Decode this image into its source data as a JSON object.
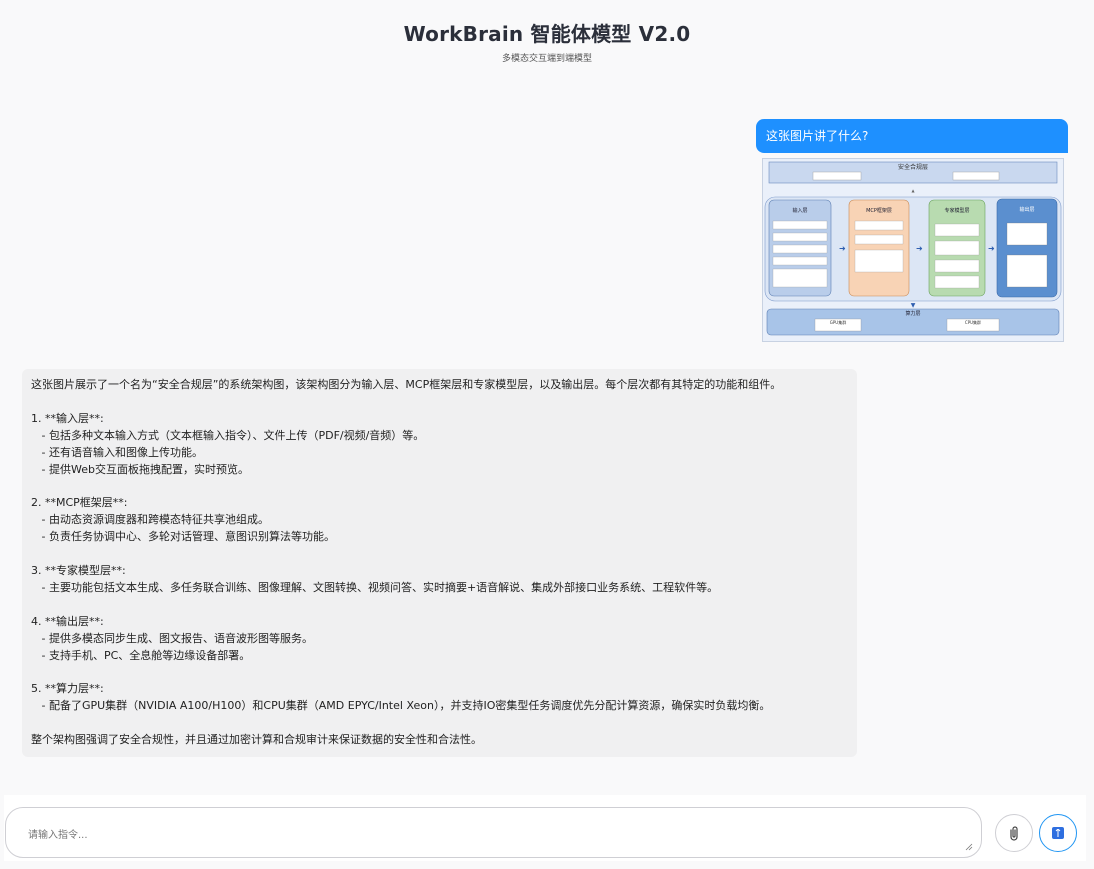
{
  "header": {
    "title": "WorkBrain 智能体模型 V2.0",
    "subtitle": "多模态交互端到端模型"
  },
  "conversation": {
    "user_message": "这张图片讲了什么?",
    "assistant_message": "这张图片展示了一个名为“安全合规层”的系统架构图，该架构图分为输入层、MCP框架层和专家模型层，以及输出层。每个层次都有其特定的功能和组件。\n\n1. **输入层**:\n   - 包括多种文本输入方式（文本框输入指令）、文件上传（PDF/视频/音频）等。\n   - 还有语音输入和图像上传功能。\n   - 提供Web交互面板拖拽配置，实时预览。\n\n2. **MCP框架层**:\n   - 由动态资源调度器和跨模态特征共享池组成。\n   - 负责任务协调中心、多轮对话管理、意图识别算法等功能。\n\n3. **专家模型层**:\n   - 主要功能包括文本生成、多任务联合训练、图像理解、文图转换、视频问答、实时摘要+语音解说、集成外部接口业务系统、工程软件等。\n\n4. **输出层**:\n   - 提供多模态同步生成、图文报告、语音波形图等服务。\n   - 支持手机、PC、全息舱等边缘设备部署。\n\n5. **算力层**:\n   - 配备了GPU集群（NVIDIA A100/H100）和CPU集群（AMD EPYC/Intel Xeon），并支持IO密集型任务调度优先分配计算资源，确保实时负载均衡。\n\n整个架构图强调了安全合规性，并且通过加密计算和合规审计来保证数据的安全性和合法性。"
  },
  "attached_image": {
    "top_layer": "安全合规层",
    "input_layer": "输入层",
    "mcp_layer": "MCP框架层",
    "expert_layer": "专家模型层",
    "output_layer": "输出层",
    "compute_layer": "算力层",
    "gpu_label": "GPU集群",
    "cpu_label": "CPU集群"
  },
  "composer": {
    "placeholder": "请输入指令..."
  },
  "icons": {
    "attach": "paperclip-icon",
    "send": "send-icon"
  },
  "colors": {
    "user_bubble": "#1e90ff",
    "send_border": "#2196f3",
    "assistant_bg": "#f0f0f1"
  }
}
